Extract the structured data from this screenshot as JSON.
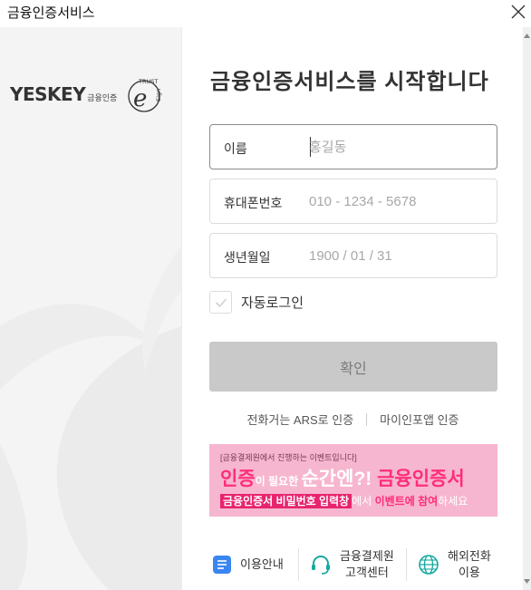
{
  "window": {
    "title": "금융인증서비스"
  },
  "brand": {
    "name": "YESKEY",
    "sub": "금융인증",
    "badge_top": "TRUST",
    "badge_letter": "e",
    "badge_side": "Sign"
  },
  "form": {
    "heading": "금융인증서비스를 시작합니다",
    "name": {
      "label": "이름",
      "placeholder": "홍길동"
    },
    "phone": {
      "label": "휴대폰번호",
      "placeholder": "010 - 1234 - 5678"
    },
    "birth": {
      "label": "생년월일",
      "placeholder": "1900 / 01 / 31"
    },
    "auto_login": "자동로그인",
    "confirm": "확인"
  },
  "alt_auth": {
    "ars": "전화거는 ARS로 인증",
    "app": "마이인포앱 인증"
  },
  "banner": {
    "line1": "[금융결제원에서 진행하는 이벤트입니다]",
    "line2_a": "인증",
    "line2_b": "이 필요한 ",
    "line2_c": "순간엔?!",
    "line2_d": " 금융인증서",
    "line3_hl": "금융인증서 비밀번호 입력창",
    "line3_mid": "에서 ",
    "line3_pk": "이벤트에 참여",
    "line3_end": "하세요"
  },
  "footer": {
    "guide": "이용안내",
    "support_1": "금융결제원",
    "support_2": "고객센터",
    "overseas_1": "해외전화",
    "overseas_2": "이용"
  },
  "colors": {
    "banner_bg": "#f7b6cf",
    "accent_pink": "#ff2d7a",
    "button_disabled": "#c9c9c9",
    "icon_blue": "#3a86f0",
    "icon_teal": "#17a9a0"
  },
  "icons": [
    "close-icon",
    "check-icon",
    "guide-icon",
    "headset-icon",
    "globe-icon"
  ]
}
